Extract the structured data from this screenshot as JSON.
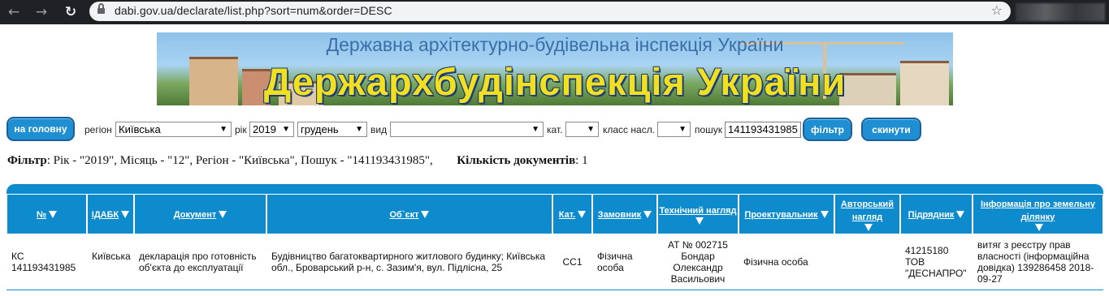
{
  "browser": {
    "url": "dabi.gov.ua/declarate/list.php?sort=num&order=DESC"
  },
  "banner": {
    "subtitle": "Державна архітектурно-будівельна інспекція України",
    "title": "Держархбудінспекція України"
  },
  "toolbar": {
    "home_button": "на головну",
    "region_label": "регіон",
    "region_value": "Київська",
    "year_label": "рік",
    "year_value": "2019",
    "month_value": "грудень",
    "type_label": "вид",
    "type_value": "",
    "cat_label": "кат.",
    "cat_value": "",
    "class_label": "класс насл.",
    "class_value": "",
    "search_label": "пошук",
    "search_value": "141193431985",
    "filter_button": "фільтр",
    "reset_button": "скинути"
  },
  "filter_summary": {
    "filter_label": "Фільтр",
    "filter_text": ": Рік - \"2019\", Місяць - \"12\", Регіон - \"Київська\", Пошук - \"141193431985\",",
    "count_label": "Кількість документів",
    "count_value": ": 1"
  },
  "table": {
    "headers": [
      "№",
      "ІДАБК",
      "Документ",
      "Об`єкт",
      "Кат.",
      "Замовник",
      "Технічний нагляд",
      "Проектувальник",
      "Авторський нагляд",
      "Підрядник",
      "Інформація про земельну ділянку"
    ],
    "rows": [
      {
        "num": "КС 141193431985",
        "idabk": "Київська",
        "document": "декларація про готовність об'єкта до експлуатації",
        "object": "Будівництво багатоквартирного житлового будинку; Київська обл., Броварський р-н, с. Зазим'я, вул. Підлісна, 25",
        "cat": "СС1",
        "customer": "Фізична особа",
        "tech_supervision": "АТ № 002715 Бондар Олександр Васильович",
        "designer": "Фізична особа",
        "author_supervision": "",
        "contractor": "41215180 ТОВ \"ДЕСНАПРО\"",
        "land_info": "витяг з реєстру прав власності (інформаційна довідка) 139286458 2018-09-27"
      }
    ]
  },
  "colors": {
    "header_blue": "#0d8bcd",
    "button_blue": "#1f8fd1",
    "banner_title": "#f0e020"
  }
}
